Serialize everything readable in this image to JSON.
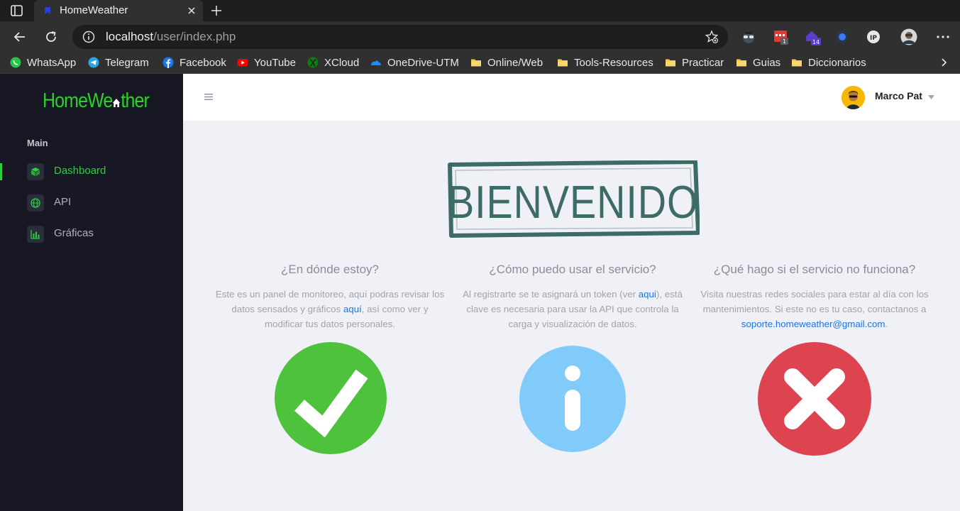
{
  "browser": {
    "tab_title": "HomeWeather",
    "url_host": "localhost",
    "url_path": "/user/index.php",
    "bookmarks": [
      {
        "label": "WhatsApp",
        "icon": "whatsapp-icon"
      },
      {
        "label": "Telegram",
        "icon": "telegram-icon"
      },
      {
        "label": "Facebook",
        "icon": "facebook-icon"
      },
      {
        "label": "YouTube",
        "icon": "youtube-icon"
      },
      {
        "label": "XCloud",
        "icon": "xbox-icon"
      },
      {
        "label": "OneDrive-UTM",
        "icon": "onedrive-icon"
      },
      {
        "label": "Online/Web",
        "icon": "folder-icon"
      },
      {
        "label": "Tools-Resources",
        "icon": "folder-icon"
      },
      {
        "label": "Practicar",
        "icon": "folder-icon"
      },
      {
        "label": "Guias",
        "icon": "folder-icon"
      },
      {
        "label": "Diccionarios",
        "icon": "folder-icon"
      }
    ],
    "extension_badges": [
      "1",
      "14"
    ]
  },
  "app": {
    "logo_text_before": "HomeWe",
    "logo_text_after": "ther",
    "sidebar": {
      "section_label": "Main",
      "items": [
        {
          "label": "Dashboard",
          "icon": "cube-icon",
          "active": true
        },
        {
          "label": "API",
          "icon": "globe-icon",
          "active": false
        },
        {
          "label": "Gráficas",
          "icon": "bar-chart-icon",
          "active": false
        }
      ]
    },
    "user": {
      "name": "Marco Pat"
    },
    "welcome_text": "BIENVENIDO",
    "columns": [
      {
        "title": "¿En dónde estoy?",
        "text_before": "Este es un panel de monitoreo, aquí podras revisar los datos sensados y gráficos ",
        "link": "aquí",
        "text_after": ", así como ver y modificar tus datos personales.",
        "icon": "checkmark-circle-icon"
      },
      {
        "title": "¿Cómo puedo usar el servicio?",
        "text_before": "Al registrarte se te asignará un token (ver ",
        "link": "aqui",
        "text_after": "), está clave es necesaria para usar la API que controla la carga y visualización de datos.",
        "icon": "info-circle-icon"
      },
      {
        "title": "¿Qué hago si el servicio no funciona?",
        "text_before": "Visita nuestras redes sociales para estar al día con los mantenimientos. Si este no es tu caso, contactanos a ",
        "link": "soporte.homeweather@gmail.com",
        "text_after": ".",
        "icon": "error-circle-icon"
      }
    ],
    "colors": {
      "accent_green": "#2ecc40",
      "check_green": "#4fc23d",
      "info_blue": "#81cbfa",
      "error_red": "#de4350",
      "sidebar_bg": "#181825",
      "welcome_ink": "#3d6b66"
    }
  }
}
